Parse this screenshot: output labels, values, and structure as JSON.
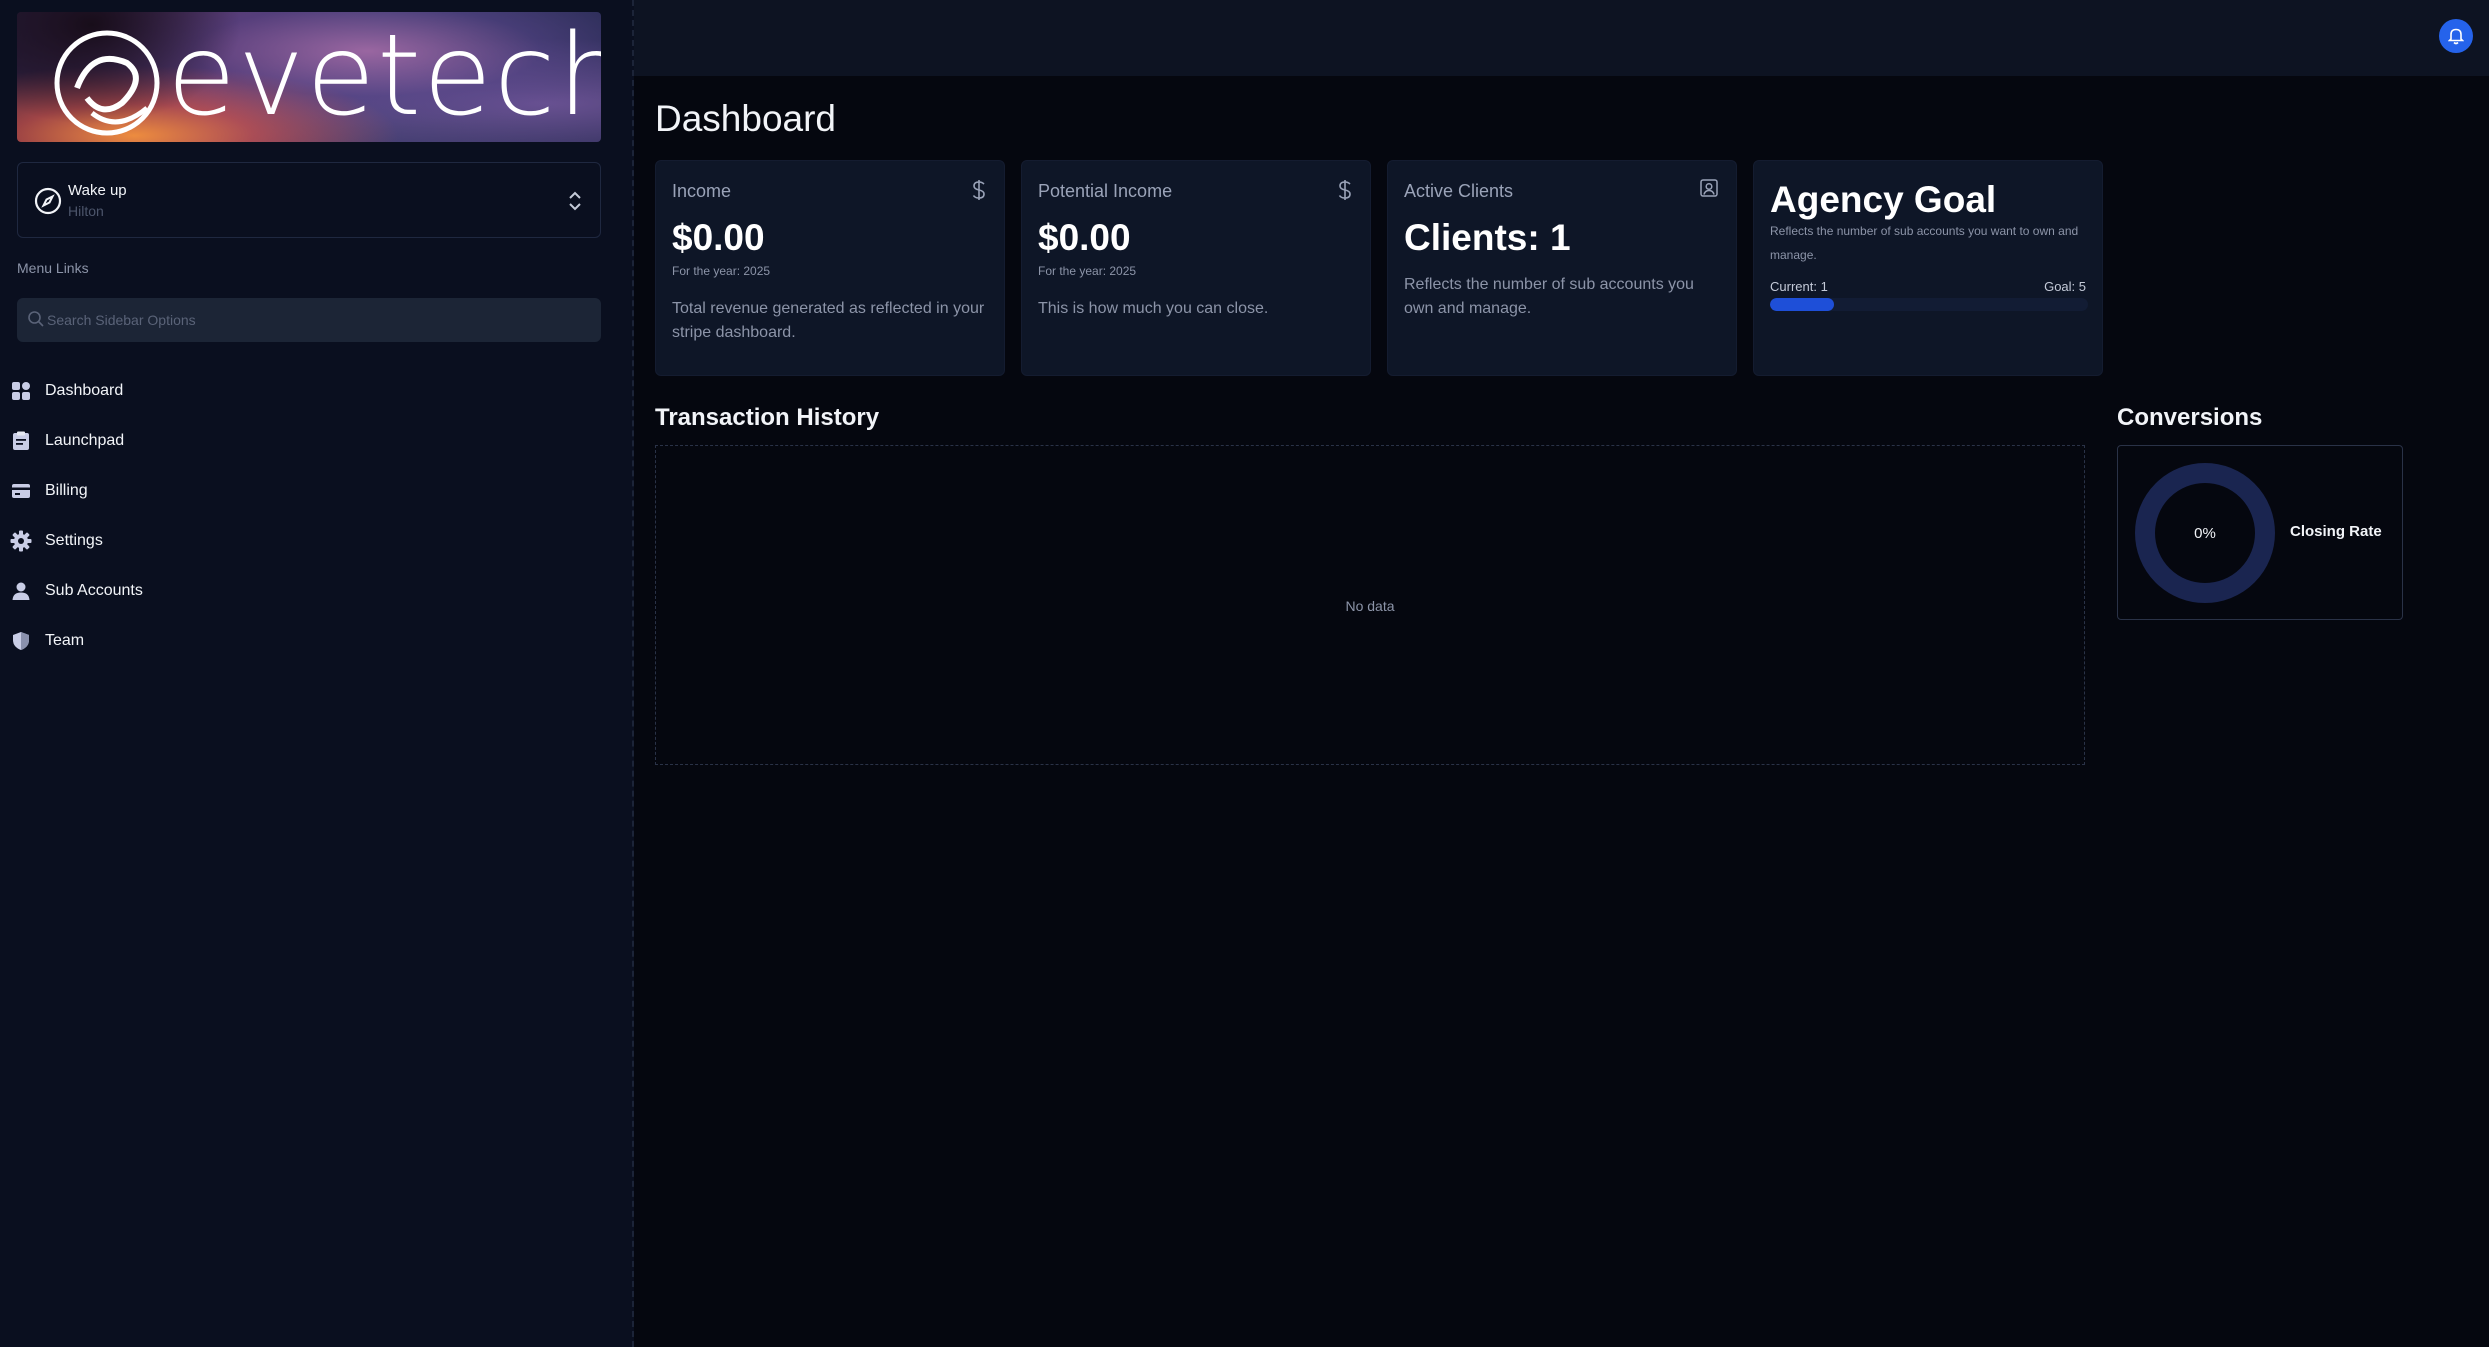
{
  "brand": {
    "logo_text": "evetech"
  },
  "account": {
    "name": "Wake up",
    "subtitle": "Hilton"
  },
  "sidebar": {
    "menu_label": "Menu Links",
    "search_placeholder": "Search Sidebar Options",
    "items": [
      {
        "label": "Dashboard",
        "icon": "dashboard-icon"
      },
      {
        "label": "Launchpad",
        "icon": "clipboard-icon"
      },
      {
        "label": "Billing",
        "icon": "credit-card-icon"
      },
      {
        "label": "Settings",
        "icon": "gear-icon"
      },
      {
        "label": "Sub Accounts",
        "icon": "user-icon"
      },
      {
        "label": "Team",
        "icon": "shield-icon"
      }
    ]
  },
  "header": {
    "notification_icon": "bell-icon"
  },
  "main": {
    "title": "Dashboard",
    "cards": {
      "income": {
        "title": "Income",
        "value": "$0.00",
        "year": "For the year: 2025",
        "description": "Total revenue generated as reflected in your stripe dashboard."
      },
      "potential": {
        "title": "Potential Income",
        "value": "$0.00",
        "year": "For the year: 2025",
        "description": "This is how much you can close."
      },
      "clients": {
        "title": "Active Clients",
        "value": "Clients: 1",
        "description": "Reflects the number of sub accounts you own and manage."
      },
      "goal": {
        "title": "Agency Goal",
        "description": "Reflects the number of sub accounts you want to own and manage.",
        "current_label": "Current: 1",
        "goal_label": "Goal: 5",
        "current": 1,
        "goal": 5
      }
    },
    "transactions": {
      "title": "Transaction History",
      "empty_text": "No data"
    },
    "conversions": {
      "title": "Conversions",
      "rate": 0,
      "rate_label": "0%",
      "caption": "Closing Rate"
    }
  },
  "colors": {
    "accent": "#2563eb",
    "progress": "#1e4fd8",
    "donut_track": "#1a2550",
    "background": "#05070f",
    "card": "#0e1627"
  }
}
